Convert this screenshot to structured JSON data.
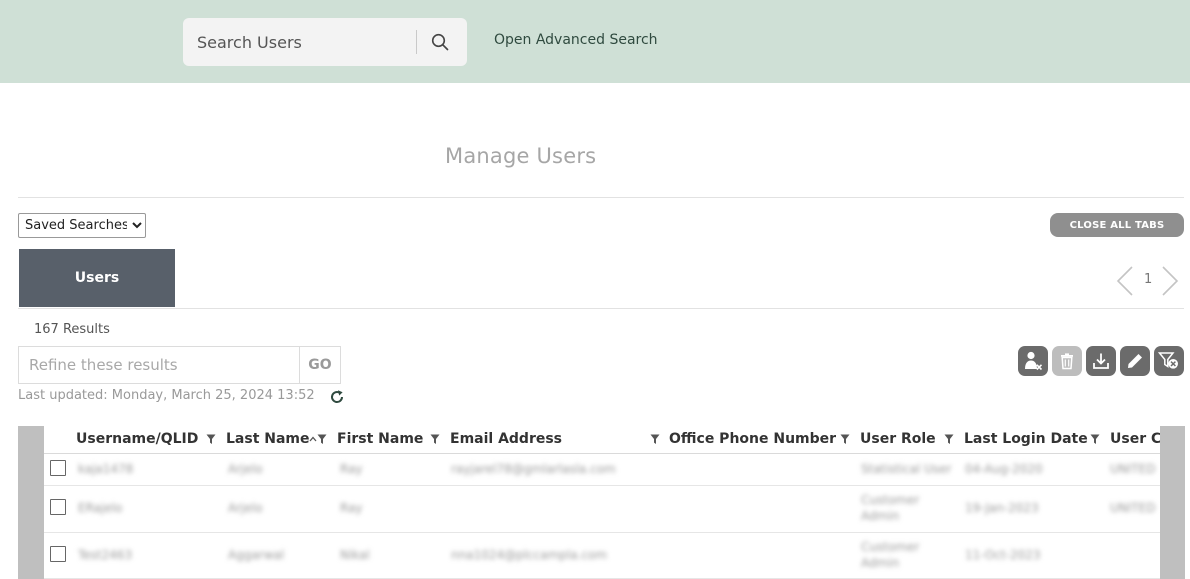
{
  "header": {
    "search_placeholder": "Search Users",
    "advanced_search_link": "Open Advanced Search"
  },
  "page": {
    "title": "Manage Users",
    "saved_searches_option": "Saved Searches",
    "close_all_tabs": "CLOSE ALL TABS",
    "tabs": [
      {
        "label": "Users"
      }
    ],
    "pager_page": "1",
    "results_count": "167 Results",
    "refine_placeholder": "Refine these results",
    "go_label": "GO",
    "last_updated": "Last updated: Monday, March 25, 2024 13:52"
  },
  "toolbar": {
    "icons": [
      "remove-user-icon",
      "delete-icon",
      "download-icon",
      "edit-icon",
      "filter-clear-icon"
    ]
  },
  "table": {
    "columns": [
      "Username/QLID",
      "Last Name",
      "First Name",
      "Email Address",
      "Office Phone Number",
      "User Role",
      "Last Login Date",
      "User Co"
    ],
    "rows": [
      {
        "username": "kaja1478",
        "last_name": "Arjelo",
        "first_name": "Ray",
        "email": "rayjarel78@gmlarlasla.com",
        "phone": "",
        "role": "Statistical User",
        "last_login": "04-Aug-2020",
        "country": "UNITED"
      },
      {
        "username": "ERajelo",
        "last_name": "Arjelo",
        "first_name": "Ray",
        "email": "",
        "phone": "",
        "role": "Customer Admin",
        "last_login": "19-Jan-2023",
        "country": "UNITED"
      },
      {
        "username": "Test2463",
        "last_name": "Aggarwal",
        "first_name": "Nikal",
        "email": "nna1024@plccampla.com",
        "phone": "",
        "role": "Customer Admin",
        "last_login": "11-Oct-2023",
        "country": ""
      }
    ]
  }
}
